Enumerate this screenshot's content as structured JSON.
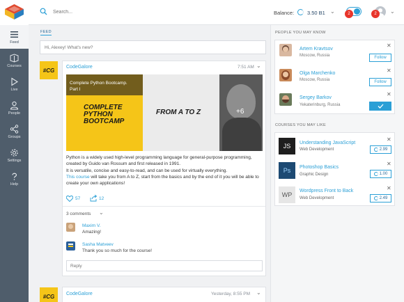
{
  "topbar": {
    "search_placeholder": "Search...",
    "balance_label": "Balance:",
    "balance_value": "3.50 B1",
    "notifications_count": "2",
    "messages_count": "2"
  },
  "sidebar": {
    "items": [
      {
        "label": "Feed",
        "icon": "menu-icon"
      },
      {
        "label": "Courses",
        "icon": "courses-icon"
      },
      {
        "label": "Live",
        "icon": "play-icon"
      },
      {
        "label": "People",
        "icon": "person-icon"
      },
      {
        "label": "Groups",
        "icon": "share-icon"
      },
      {
        "label": "Settings",
        "icon": "gear-icon"
      },
      {
        "label": "Help",
        "icon": "question-icon"
      }
    ]
  },
  "feed": {
    "title": "FEED",
    "composer_placeholder": "Hi, Alexey! What's new?",
    "post": {
      "author": "CodeGalore",
      "avatar_text": "#CG",
      "time": "7:51 AM",
      "media": {
        "title_line1": "Complete Python Bootcamp.",
        "title_line2": "Part I",
        "cover_line1": "COMPLETE",
        "cover_line2": "PYTHON",
        "cover_line3": "BOOTCAMP",
        "middle_text": "FROM A TO Z",
        "more_count": "+6"
      },
      "text_1": "Python is a widely used high-level programming language for general-purpose programming, created by Guido van Rossum and first released in 1991.",
      "text_2": "It is versatile, concise and easy-to-read, and can be used for virtually everything.",
      "text_link": "This course",
      "text_3": " will take you from A to Z, start from the basics and by the end of it you will be able to create your own applications!",
      "likes": "57",
      "shares": "12",
      "comments_label": "3 comments",
      "comments": [
        {
          "author": "Maxim V.",
          "text": "Amazing!"
        },
        {
          "author": "Sasha Matveev",
          "text": "Thank you so much for the course!"
        }
      ],
      "reply_placeholder": "Reply"
    },
    "post2": {
      "author": "CodeGalore",
      "avatar_text": "#CG",
      "time": "Yesterday, 8:55 PM"
    }
  },
  "people": {
    "title": "PEOPLE YOU MAY KNOW",
    "follow_label": "Follow",
    "items": [
      {
        "name": "Artem Kravtsov",
        "location": "Moscow, Russia"
      },
      {
        "name": "Olga Marchenko",
        "location": "Moscow, Russia"
      },
      {
        "name": "Sergey Barkov",
        "location": "Yekaterinburg, Russia"
      }
    ]
  },
  "courses": {
    "title": "COURSES YOU MAY LIKE",
    "items": [
      {
        "name": "Understanding JavaScript",
        "category": "Web Development",
        "price": "2.99",
        "badge": "JS"
      },
      {
        "name": "Photoshop Basics",
        "category": "Graphic Design",
        "price": "1.00",
        "badge": "Ps"
      },
      {
        "name": "Wordpress Front to Back",
        "category": "Web Development",
        "price": "2.49",
        "badge": "WP"
      }
    ]
  },
  "colors": {
    "accent": "#2a9fd6",
    "sidebar": "#4f5d6b",
    "badge": "#e8352b",
    "brand_yellow": "#f5c518"
  }
}
